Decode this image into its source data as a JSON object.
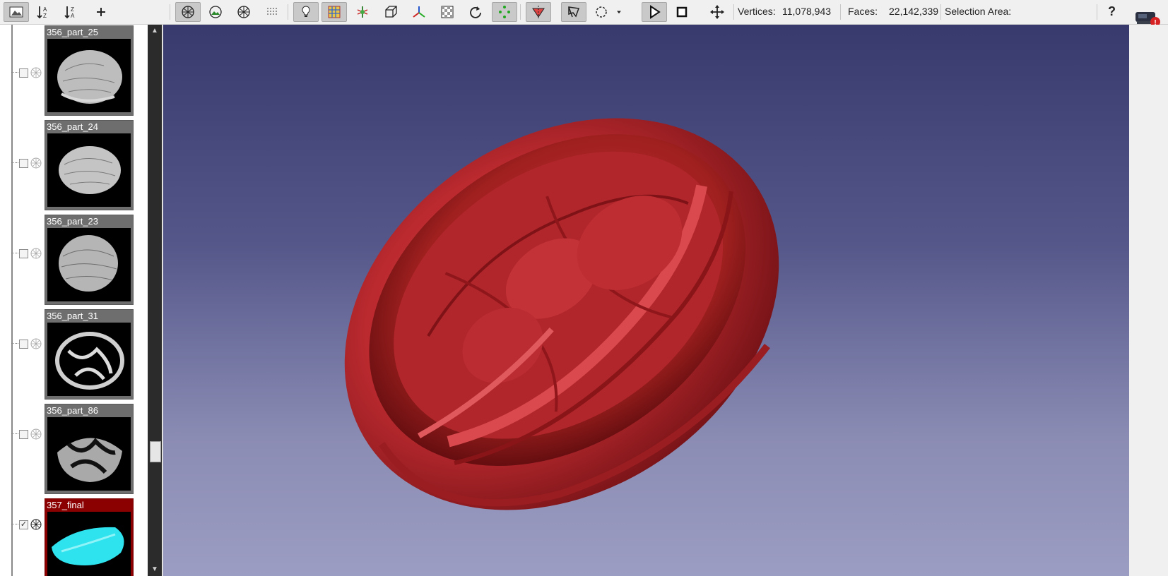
{
  "toolbar": {
    "icons": [
      "layer-dialog-icon",
      "sort-ascending-icon",
      "sort-descending-icon",
      "add-icon",
      "wireframe-sphere-icon",
      "image-snapshot-icon",
      "wireframe-sphere-icon",
      "points-render-icon",
      "light-icon",
      "color-grid-icon",
      "transform-icon",
      "bounding-box-icon",
      "axes-icon",
      "texture-icon",
      "rotate-icon",
      "vertex-selection-icon",
      "face-selection-icon",
      "polygon-select-icon",
      "lasso-select-icon",
      "dropdown-icon",
      "play-icon",
      "stop-icon",
      "move-icon",
      "help-icon"
    ],
    "vertices_label": "Vertices:",
    "vertices_value": "11,078,943",
    "faces_label": "Faces:",
    "faces_value": "22,142,339",
    "selection_label": "Selection Area:",
    "help_label": "?"
  },
  "layers": [
    {
      "name": "356_part_25",
      "checked": false,
      "selected": false
    },
    {
      "name": "356_part_24",
      "checked": false,
      "selected": false
    },
    {
      "name": "356_part_23",
      "checked": false,
      "selected": false
    },
    {
      "name": "356_part_31",
      "checked": false,
      "selected": false
    },
    {
      "name": "356_part_86",
      "checked": false,
      "selected": false
    },
    {
      "name": "357_final",
      "checked": true,
      "selected": true
    }
  ],
  "colors": {
    "selected_layer": "#8b0000",
    "mesh": "#c0272d",
    "final_thumb": "#2fe3ee"
  }
}
